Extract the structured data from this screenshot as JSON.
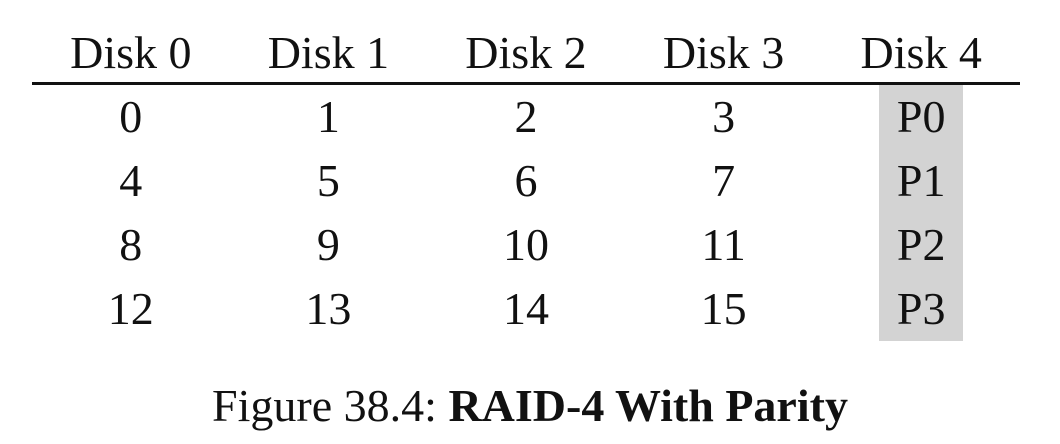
{
  "table": {
    "headers": [
      "Disk 0",
      "Disk 1",
      "Disk 2",
      "Disk 3",
      "Disk 4"
    ],
    "rows": [
      [
        "0",
        "1",
        "2",
        "3",
        "P0"
      ],
      [
        "4",
        "5",
        "6",
        "7",
        "P1"
      ],
      [
        "8",
        "9",
        "10",
        "11",
        "P2"
      ],
      [
        "12",
        "13",
        "14",
        "15",
        "P3"
      ]
    ],
    "parity_highlight_color": "#d3d3d3"
  },
  "caption": {
    "label": "Figure 38.4:",
    "title": "RAID-4 With Parity"
  }
}
